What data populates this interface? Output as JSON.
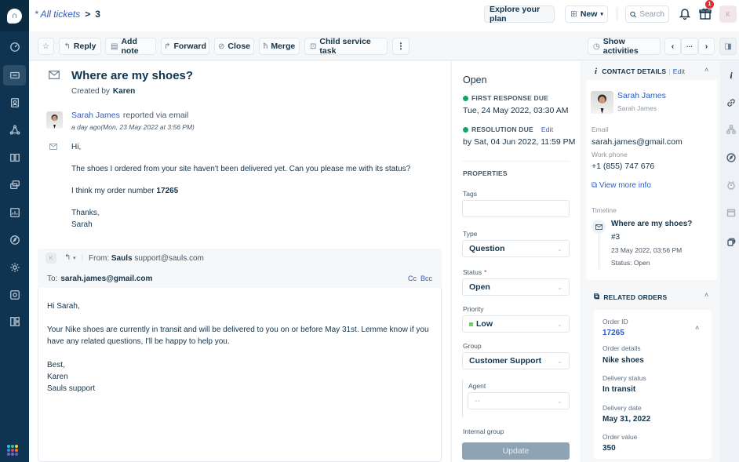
{
  "header": {
    "breadcrumb_link": "* All tickets",
    "breadcrumb_sep": ">",
    "ticket_number": "3",
    "explore_plan": "Explore your plan",
    "new_label": "New",
    "search_placeholder": "Search",
    "gift_badge": "1",
    "user_initial": "K"
  },
  "toolbar": {
    "reply": "Reply",
    "add_note": "Add note",
    "forward": "Forward",
    "close": "Close",
    "merge": "Merge",
    "child_task": "Child service task",
    "more": "⋮",
    "show_activities": "Show activities",
    "prev": "‹",
    "ellipsis": "···",
    "next": "›"
  },
  "ticket": {
    "title": "Where are my shoes?",
    "created_by_label": "Created by",
    "created_by": "Karen",
    "reporter_name": "Sarah James",
    "reporter_via": "reported via email",
    "reported_time": "a day ago(Mon, 23 May 2022 at 3:56 PM)",
    "body": {
      "greeting": "Hi,",
      "line1": "The shoes I ordered from your site haven't been delivered yet. Can you please me with its status?",
      "line2_prefix": "I think my order number",
      "order_number": "17265",
      "signoff": "Thanks,",
      "name": "Sarah"
    }
  },
  "reply": {
    "avatar_initial": "K",
    "from_label": "From:",
    "from_name": "Sauls",
    "from_email": "support@sauls.com",
    "to_label": "To:",
    "to_email": "sarah.james@gmail.com",
    "cc": "Cc",
    "bcc": "Bcc",
    "body": {
      "greeting": "Hi Sarah,",
      "line1": "Your Nike shoes are currently in transit and will be delivered to you on or before May 31st. Lemme know if you",
      "line2": "have any related questions, I'll be happy to help you.",
      "signoff": "Best,",
      "name": "Karen",
      "team": "Sauls support"
    }
  },
  "properties": {
    "status_heading": "Open",
    "first_response_label": "FIRST RESPONSE DUE",
    "first_response_date": "Tue, 24 May 2022, 03:30 AM",
    "resolution_label": "RESOLUTION DUE",
    "resolution_edit": "Edit",
    "resolution_date": "by Sat, 04 Jun 2022, 11:59 PM",
    "section_title": "PROPERTIES",
    "tags_label": "Tags",
    "tags_value": "",
    "type_label": "Type",
    "type_value": "Question",
    "status_label": "Status",
    "status_required": "*",
    "status_value": "Open",
    "priority_label": "Priority",
    "priority_value": "Low",
    "priority_color": "#6fcf6b",
    "group_label": "Group",
    "group_value": "Customer Support",
    "agent_label": "Agent",
    "agent_value": "--",
    "internal_group_label": "Internal group",
    "update_button": "Update"
  },
  "contact": {
    "title": "CONTACT DETAILS",
    "edit": "Edit",
    "name": "Sarah James",
    "subname": "Sarah James",
    "email_label": "Email",
    "email": "sarah.james@gmail.com",
    "phone_label": "Work phone",
    "phone": "+1 (855) 747 676",
    "view_more": "View more info",
    "timeline_label": "Timeline",
    "timeline_title": "Where are my shoes?",
    "timeline_num": "#3",
    "timeline_date": "23 May 2022, 03:56 PM",
    "timeline_status": "Status: Open"
  },
  "orders": {
    "title": "RELATED ORDERS",
    "order_id_label": "Order ID",
    "order_id": "17265",
    "details_label": "Order details",
    "details": "Nike shoes",
    "delivery_status_label": "Delivery status",
    "delivery_status": "In transit",
    "delivery_date_label": "Delivery date",
    "delivery_date": "May 31, 2022",
    "value_label": "Order value",
    "value": "350"
  },
  "colors": {
    "nav_bg": "#0e3451",
    "link": "#2c5cc5",
    "sla_green": "#16a36a",
    "update_btn": "#8ea3b4"
  }
}
